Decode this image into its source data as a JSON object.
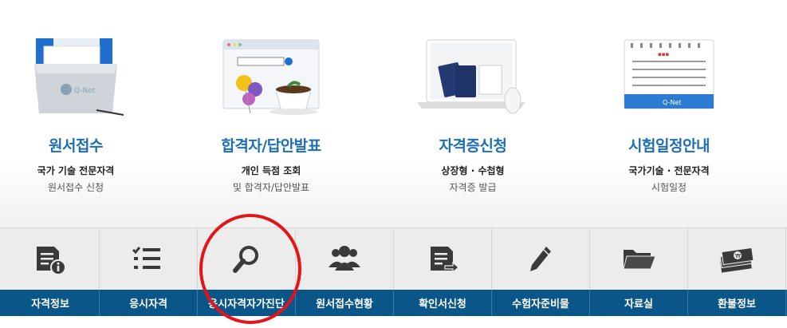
{
  "cards": [
    {
      "title": "원서접수",
      "desc1": "국가 기술 전문자격",
      "desc2": "원서접수 신청",
      "icon": "folder-qnet-icon",
      "logo": "Q-Net"
    },
    {
      "title": "합격자/답안발표",
      "desc1": "개인 득점 조회",
      "desc2": "및 합격자/답안발표",
      "icon": "browser-teacup-icon"
    },
    {
      "title": "자격증신청",
      "desc1": "상장형 · 수첩형",
      "desc2": "자격증 발급",
      "icon": "laptop-passport-icon"
    },
    {
      "title": "시험일정안내",
      "desc1": "국가기술 · 전문자격",
      "desc2": "시험일정",
      "icon": "calendar-icon",
      "logo": "Q-Net"
    }
  ],
  "menu": [
    {
      "label": "자격정보",
      "icon": "document-info-icon"
    },
    {
      "label": "응시자격",
      "icon": "checklist-icon"
    },
    {
      "label": "응시자격자가진단",
      "icon": "search-icon"
    },
    {
      "label": "원서접수현황",
      "icon": "users-icon"
    },
    {
      "label": "확인서신청",
      "icon": "document-arrow-icon"
    },
    {
      "label": "수험자준비물",
      "icon": "pencil-icon"
    },
    {
      "label": "자료실",
      "icon": "folder-icon"
    },
    {
      "label": "환불정보",
      "icon": "cash-icon"
    }
  ],
  "colors": {
    "title": "#1d6fb5",
    "menu_bg": "#0a5688",
    "highlight": "#e3151a",
    "icon": "#3a3a3a"
  }
}
